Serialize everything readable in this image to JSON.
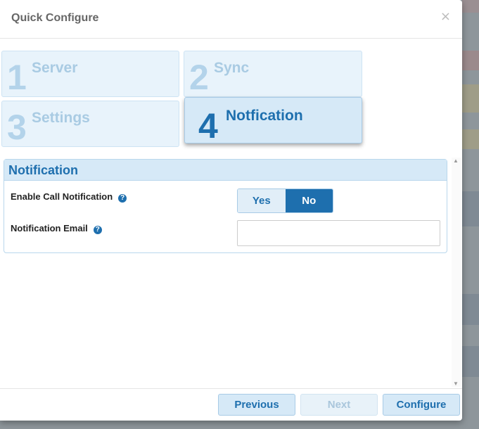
{
  "dialog": {
    "title": "Quick Configure",
    "close_glyph": "×"
  },
  "steps": [
    {
      "number": "1",
      "label": "Server",
      "active": false
    },
    {
      "number": "2",
      "label": "Sync",
      "active": false
    },
    {
      "number": "3",
      "label": "Settings",
      "active": false
    },
    {
      "number": "4",
      "label": "Notfication",
      "active": true
    }
  ],
  "panel": {
    "title": "Notification",
    "fields": {
      "call_notification": {
        "label": "Enable Call Notification",
        "options": [
          "Yes",
          "No"
        ],
        "selected": "No"
      },
      "email": {
        "label": "Notification Email",
        "value": "",
        "placeholder": ""
      }
    },
    "help_glyph": "?"
  },
  "footer": {
    "previous_label": "Previous",
    "next_label": "Next",
    "configure_label": "Configure"
  },
  "colors": {
    "accent": "#1e6fae",
    "step_bg": "#e8f3fb",
    "active_step_bg": "#d6e9f7"
  }
}
